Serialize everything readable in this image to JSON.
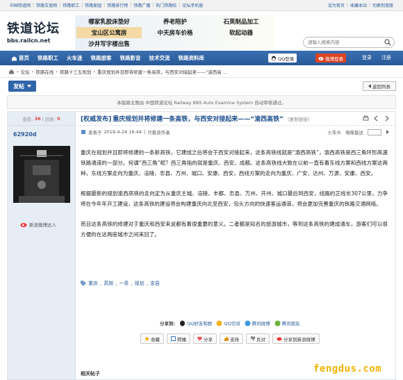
{
  "topbar": {
    "links": [
      "中国铁道网",
      "铁路车迷网",
      "铁路职工",
      "铁路家园",
      "铁路排行榜",
      "铁路广播",
      "热门铁路帖",
      "论坛手机版"
    ],
    "right": [
      "设为首页",
      "收藏本站",
      "切换到宽版"
    ]
  },
  "logo": {
    "title": "铁道论坛",
    "url": "bbs.railcn.net"
  },
  "ads": [
    "哪家乳胶床垫好",
    "养老陪护",
    "石英制品加工",
    "宝山区公寓房",
    "中天房车价格",
    "软起动器",
    "沙井写字楼出售"
  ],
  "search": {
    "placeholder": "请输入搜索内容"
  },
  "nav": {
    "home": "首页",
    "items": [
      "铁路职工",
      "火车迷",
      "铁路旅客",
      "铁路影音",
      "技术交流",
      "铁路资料库"
    ],
    "qq_login": "QQ登录",
    "weibo_login": "微博登录",
    "login": "登录",
    "register": "注册"
  },
  "breadcrumb": [
    "论坛",
    "铁路在线",
    "铁路十三五规划",
    "重庆规划并且即将修建一条高铁，与西安对接起来——“渝西高 ..."
  ],
  "actions": {
    "post": "发帖",
    "back": "返回列表"
  },
  "notice": "本版路主题由 中国铁道论坛 Railway BBS Auto Examine System 自动审核通过。",
  "thread": {
    "views_label": "查看:",
    "views": "36",
    "replies_label": "回复:",
    "replies": "0",
    "author": "62920d",
    "weibo_follow": "新浪微博达人",
    "category": "[权威发布]",
    "title": "重庆规划并将修建一条高铁，与西安对接起来——“渝西高铁”",
    "copy_link": "[复制链接]",
    "posted_label": "发表于",
    "posted_time": "2019-4-24 16:44",
    "only_author": "只看该作者",
    "floor_label": "火车头",
    "jump_label": "电梯直达",
    "paragraphs": [
      "重庆在规划并且即将修建的一条新高铁，它建成之后将会于西安对接起来，这条高铁线就是“渝西高铁”，渝西高铁是西三角环形高速铁路通道的一部分。何谓“西三角”呢？西三角指的就是重庆、西安、成都。这条高铁线大致在以前一直有着东线方案和西线方案这两种，东线方案走向为重庆、涪陵、忠县、万州、城口、安康、西安，西线方案的走向为重庆、广安、达州、万源、安康、西安。",
      "根据最新的规划渝西高铁的走向定为从重庆主城、涪陵、丰都、忠县、万州、开州、城口最后到西安，线路的正线长307公里，力争将在今年年开工建设，这条高铁的建设将会构建重庆向北至西安，包头方向的快速客运通道，将会更加完善重庆的铁路交通网络。",
      "而且这条高铁的修建对于重庆和西安来说都有着很重要的意义。二者都是知名的旅游城市，等到这条高铁的建成通车，游客们可以很方便的在这两座城市之间来回了。"
    ],
    "tags": [
      "重庆",
      "高铁",
      "一条",
      "规划",
      "忠县"
    ],
    "share_label": "分享到:",
    "share": [
      "QQ好友和群",
      "QQ空间",
      "腾讯微博",
      "腾讯朋友"
    ],
    "buttons": [
      "收藏",
      "转播",
      "分享",
      "支持",
      "反对",
      "分享到新浪微博"
    ],
    "related": "相关帖子"
  },
  "watermark": "fengdus.com",
  "colors": {
    "nav_blue": "#2f64a8",
    "sidebar": "#e6edf5",
    "watermark": "#f0b400",
    "link": "#2a5b9a"
  }
}
